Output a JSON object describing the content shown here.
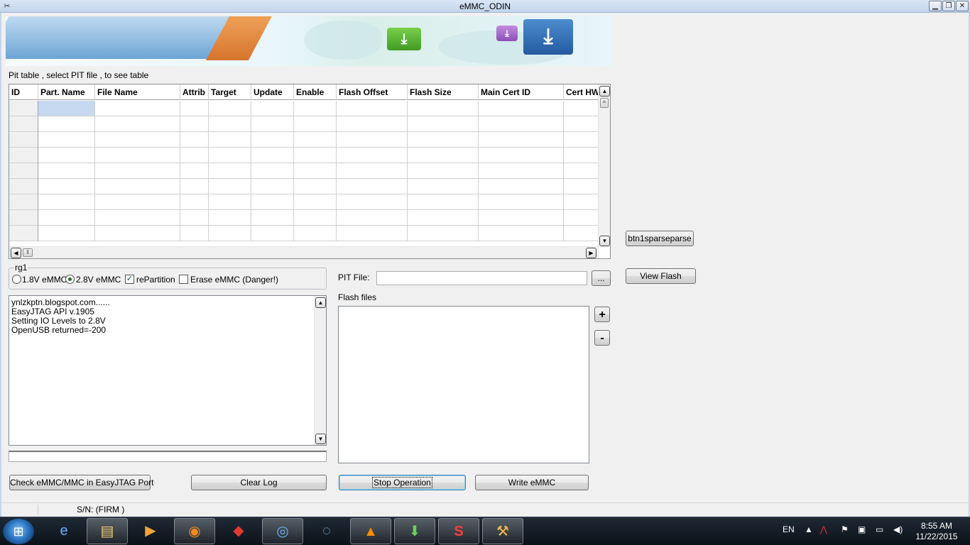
{
  "window": {
    "title": "eMMC_ODIN",
    "app_icon": "tools-icon"
  },
  "labels": {
    "pit_table_hint": "Pit table , select PIT file , to see table",
    "group_title": "rg1",
    "pit_file": "PIT File:",
    "flash_files": "Flash files"
  },
  "grid": {
    "columns": [
      "ID",
      "Part. Name",
      "File Name",
      "Attrib",
      "Target",
      "Update",
      "Enable",
      "Flash Offset",
      "Flash Size",
      "Main Cert ID",
      "Cert HW"
    ],
    "row_count": 9
  },
  "options": {
    "v18": {
      "label": "1.8V eMMC",
      "selected": false
    },
    "v28": {
      "label": "2.8V eMMC",
      "selected": true
    },
    "repartition": {
      "label": "rePartition",
      "checked": true
    },
    "erase": {
      "label": "Erase eMMC (Danger!)",
      "checked": false
    }
  },
  "log": {
    "lines": [
      "ynlzkptn.blogspot.com......",
      "EasyJTAG API v.1905",
      "Setting IO Levels to 2.8V",
      "OpenUSB returned=-200"
    ]
  },
  "buttons": {
    "check": "Check eMMC/MMC in EasyJTAG Port",
    "clear_log": "Clear Log",
    "stop": "Stop Operation",
    "write": "Write eMMC",
    "browse": "...",
    "add": "+",
    "remove": "-",
    "sparse": "btn1sparseparse",
    "view_flash": "View Flash"
  },
  "status": {
    "sn": "S/N:  (FIRM )"
  },
  "taskbar": {
    "language": "EN",
    "time": "8:55 AM",
    "date": "11/22/2015",
    "apps": [
      "internet-explorer-icon",
      "file-explorer-icon",
      "media-player-icon",
      "firefox-icon",
      "pdf-tool-icon",
      "chrome-icon",
      "weibo-icon",
      "vlc-icon",
      "download-manager-icon",
      "s-app-icon",
      "emmc-tool-icon"
    ]
  },
  "colors": {
    "selected_cell": "#c6d9f0",
    "taskbar": "#0b1118"
  }
}
